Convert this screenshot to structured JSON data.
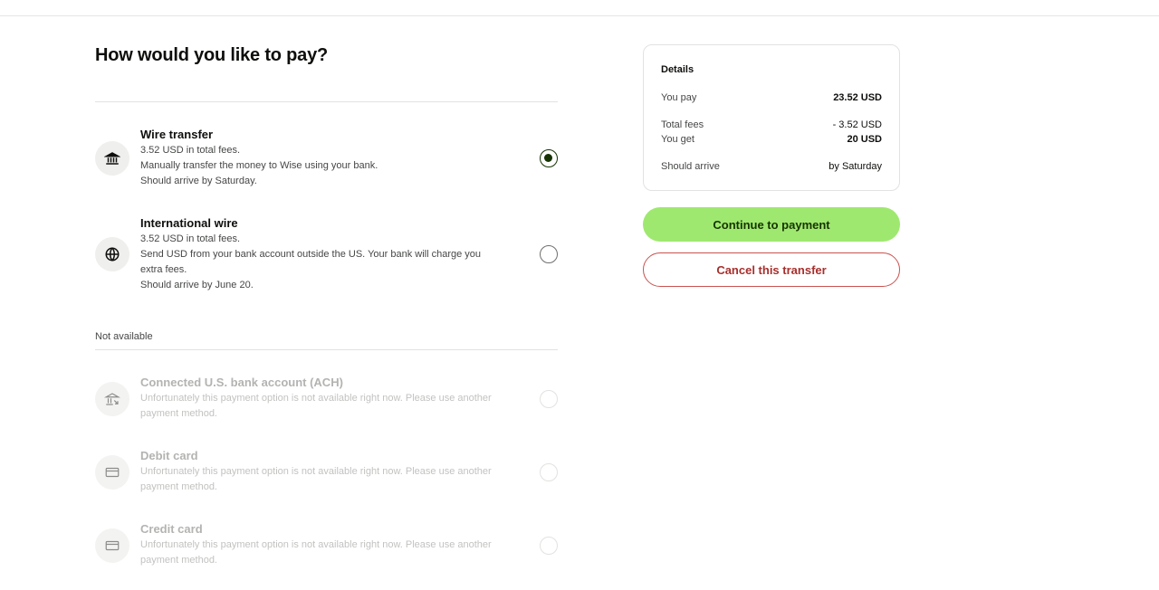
{
  "page": {
    "title": "How would you like to pay?"
  },
  "options": [
    {
      "title": "Wire transfer",
      "lines": [
        "3.52 USD in total fees.",
        "Manually transfer the money to Wise using your bank.",
        "Should arrive by Saturday."
      ],
      "icon": "bank-icon",
      "selected": true
    },
    {
      "title": "International wire",
      "lines": [
        "3.52 USD in total fees.",
        "Send USD from your bank account outside the US. Your bank will charge you",
        "extra fees.",
        "Should arrive by June 20."
      ],
      "icon": "globe-icon",
      "selected": false
    }
  ],
  "unavailable": {
    "label": "Not available",
    "options": [
      {
        "title": "Connected U.S. bank account (ACH)",
        "lines": [
          "Unfortunately this payment option is not available right now. Please use another",
          "payment method."
        ],
        "icon": "bank-transfer-icon"
      },
      {
        "title": "Debit card",
        "lines": [
          "Unfortunately this payment option is not available right now. Please use another",
          "payment method."
        ],
        "icon": "card-icon"
      },
      {
        "title": "Credit card",
        "lines": [
          "Unfortunately this payment option is not available right now. Please use another",
          "payment method."
        ],
        "icon": "card-icon"
      }
    ]
  },
  "details": {
    "title": "Details",
    "you_pay_label": "You pay",
    "you_pay_value": "23.52 USD",
    "total_fees_label": "Total fees",
    "total_fees_value": "- 3.52 USD",
    "you_get_label": "You get",
    "you_get_value": "20 USD",
    "arrive_label": "Should arrive",
    "arrive_value": "by Saturday"
  },
  "actions": {
    "continue_label": "Continue to payment",
    "cancel_label": "Cancel this transfer"
  },
  "colors": {
    "accent": "#9fe870",
    "accent_dark": "#163300",
    "danger": "#a72f2c"
  }
}
